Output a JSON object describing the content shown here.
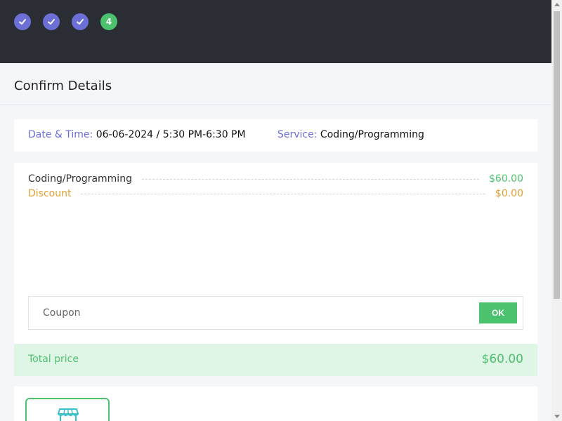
{
  "stepper": {
    "steps": [
      {
        "state": "done",
        "icon": "check-icon"
      },
      {
        "state": "done",
        "icon": "check-icon"
      },
      {
        "state": "done",
        "icon": "check-icon"
      },
      {
        "state": "current",
        "label": "4"
      }
    ]
  },
  "page": {
    "title": "Confirm Details"
  },
  "info": {
    "datetime_label": "Date & Time:",
    "datetime_value": "06-06-2024 / 5:30 PM-6:30 PM",
    "service_label": "Service:",
    "service_value": "Coding/Programming"
  },
  "summary": {
    "service_name": "Coding/Programming",
    "service_price": "$60.00",
    "discount_label": "Discount",
    "discount_value": "$0.00"
  },
  "coupon": {
    "placeholder": "Coupon",
    "value": "",
    "button_label": "OK"
  },
  "total": {
    "label": "Total price",
    "value": "$60.00"
  },
  "payment": {
    "option_icon": "store-icon"
  },
  "colors": {
    "header_bg": "#2a2d34",
    "step_done": "#6c6fd6",
    "step_current": "#4cc26e",
    "accent_green": "#4cc26e",
    "discount_orange": "#e0a030",
    "total_bg": "#dff5e5"
  }
}
